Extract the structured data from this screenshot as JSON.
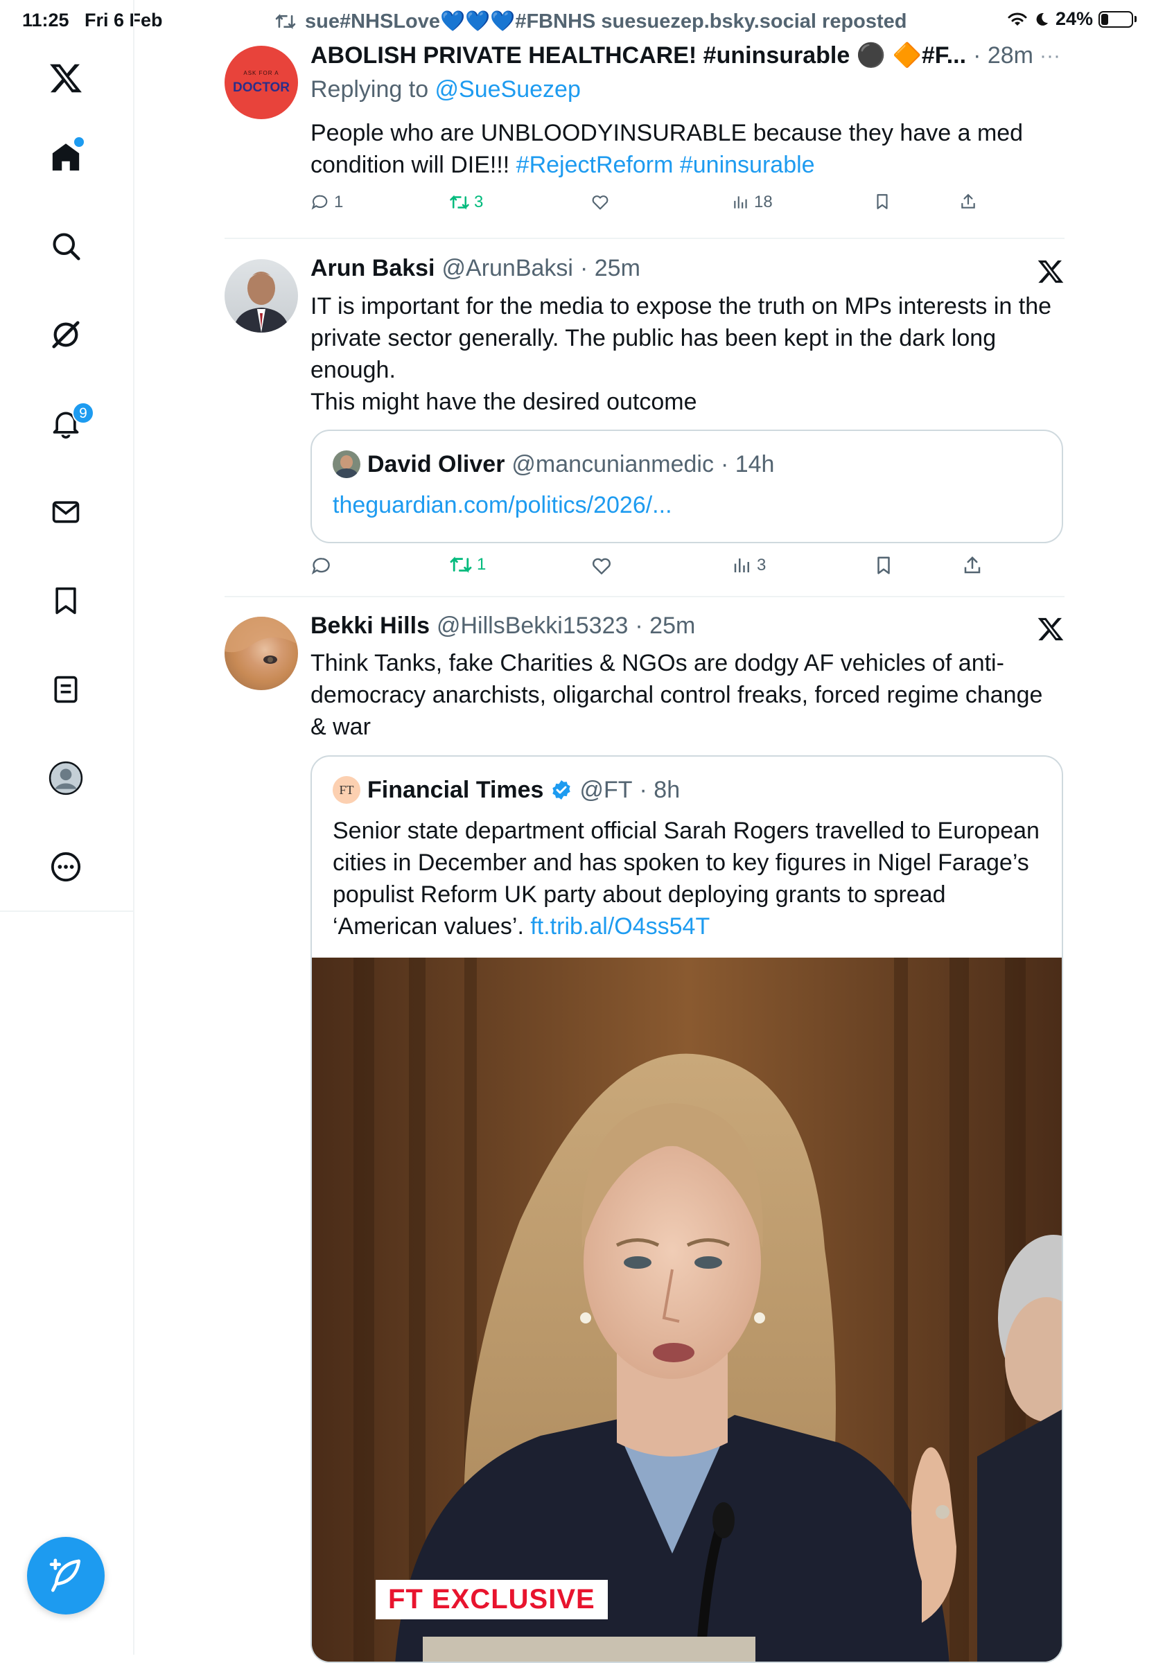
{
  "status_bar": {
    "time": "11:25",
    "date": "Fri 6 Feb",
    "battery": "24%",
    "battery_level": 0.24
  },
  "sidebar": {
    "items": [
      {
        "name": "x-logo-icon"
      },
      {
        "name": "home-icon"
      },
      {
        "name": "search-icon"
      },
      {
        "name": "grok-icon"
      },
      {
        "name": "notifications-icon"
      },
      {
        "name": "messages-icon"
      },
      {
        "name": "bookmarks-icon"
      },
      {
        "name": "lists-icon"
      },
      {
        "name": "profile-icon"
      },
      {
        "name": "more-icon"
      }
    ],
    "notification_count": "9"
  },
  "repost_banner": "sue#NHSLove💙💙💙#FBNHS suesuezep.bsky.social reposted",
  "tweets": [
    {
      "name": "ABOLISH PRIVATE HEALTHCARE! #uninsurable ⚫ 🔶#F...",
      "time": "· 28m",
      "replying_prefix": "Replying to ",
      "replying_handle": "@SueSuezep",
      "avatar_text_top": "ASK FOR A",
      "avatar_text": "DOCTOR",
      "text": "People who are UNBLOODYINSURABLE because they have a med condition will DIE!!! ",
      "hashtags": "#RejectReform #uninsurable",
      "replies": "1",
      "reposts": "3",
      "views": "18"
    },
    {
      "name": "Arun Baksi",
      "handle": "@ArunBaksi",
      "time": "· 25m",
      "text_lines": [
        "IT is important for the media to expose the truth on MPs interests in the",
        "private sector generally. The public has been kept in the dark long",
        "enough.",
        "This might have the desired outcome"
      ],
      "quote": {
        "name": "David Oliver",
        "handle": "@mancunianmedic",
        "time": "· 14h",
        "link": "theguardian.com/politics/2026/..."
      },
      "reposts": "1",
      "views": "3"
    },
    {
      "name": "Bekki Hills",
      "handle": "@HillsBekki15323",
      "time": "· 25m",
      "text_lines": [
        "Think Tanks, fake Charities & NGOs are dodgy AF vehicles of anti-",
        "democracy anarchists, oligarchal control freaks, forced regime change",
        "& war"
      ],
      "quote": {
        "avatar_text": "FT",
        "name": "Financial Times",
        "handle": "@FT",
        "time": "· 8h",
        "text_lines": [
          "Senior state department official Sarah Rogers travelled to European",
          "cities in December and has spoken to key figures in Nigel Farage’s",
          "populist Reform UK party about deploying grants to spread"
        ],
        "last_line": "‘American values’. ",
        "link": "ft.trib.al/O4ss54T",
        "image_caption": "FT EXCLUSIVE"
      }
    }
  ],
  "colors": {
    "accent": "#1d9bf0",
    "repost_green": "#00ba7c",
    "text": "#0f1419",
    "muted": "#536471",
    "ft_pink": "#fcd0b1"
  }
}
